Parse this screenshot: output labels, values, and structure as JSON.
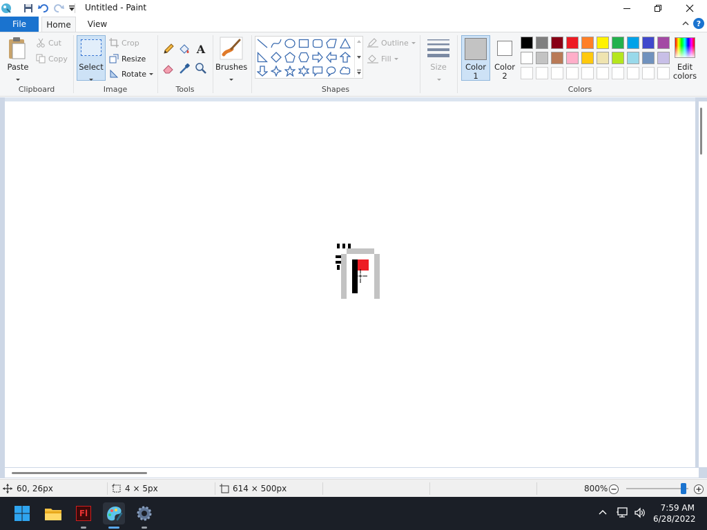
{
  "window": {
    "title": "Untitled - Paint",
    "controls": {
      "minimize": "minimize",
      "maximize": "maximize",
      "close": "close"
    }
  },
  "quick_access": [
    "save-icon",
    "undo-icon",
    "redo-icon",
    "customize-icon"
  ],
  "tabs": [
    {
      "label": "File"
    },
    {
      "label": "Home"
    },
    {
      "label": "View"
    }
  ],
  "ribbon": {
    "clipboard": {
      "paste": "Paste",
      "cut": "Cut",
      "copy": "Copy",
      "group": "Clipboard"
    },
    "image": {
      "select": "Select",
      "crop": "Crop",
      "resize": "Resize",
      "rotate": "Rotate",
      "group": "Image"
    },
    "tools": {
      "group": "Tools"
    },
    "brushes": {
      "label": "Brushes"
    },
    "shapes": {
      "outline": "Outline",
      "fill": "Fill",
      "group": "Shapes"
    },
    "size": {
      "label": "Size"
    },
    "color1": {
      "label1": "Color",
      "label2": "1",
      "value": "#c3c3c3"
    },
    "color2": {
      "label1": "Color",
      "label2": "2",
      "value": "#ffffff"
    },
    "colors": {
      "group": "Colors",
      "row1": [
        "#000000",
        "#7f7f7f",
        "#880015",
        "#ed1c24",
        "#ff7f27",
        "#fff200",
        "#22b14c",
        "#00a2e8",
        "#3f48cc",
        "#a349a4"
      ],
      "row2": [
        "#ffffff",
        "#c3c3c3",
        "#b97a57",
        "#ffaec9",
        "#ffc90e",
        "#efe4b0",
        "#b5e61d",
        "#99d9ea",
        "#7092be",
        "#c8bfe7"
      ]
    },
    "edit_colors": {
      "label1": "Edit",
      "label2": "colors"
    }
  },
  "status": {
    "cursor_pos": "60, 26px",
    "selection_size": "4 × 5px",
    "canvas_size": "614 × 500px",
    "zoom": "800%",
    "zoom_fraction": 0.92
  },
  "taskbar": {
    "apps": [
      "windows-start-icon",
      "file-explorer-icon",
      "flash-icon",
      "paint-icon",
      "settings-icon"
    ],
    "flash_label": "Fl",
    "time": "7:59 AM",
    "date": "6/28/2022"
  }
}
